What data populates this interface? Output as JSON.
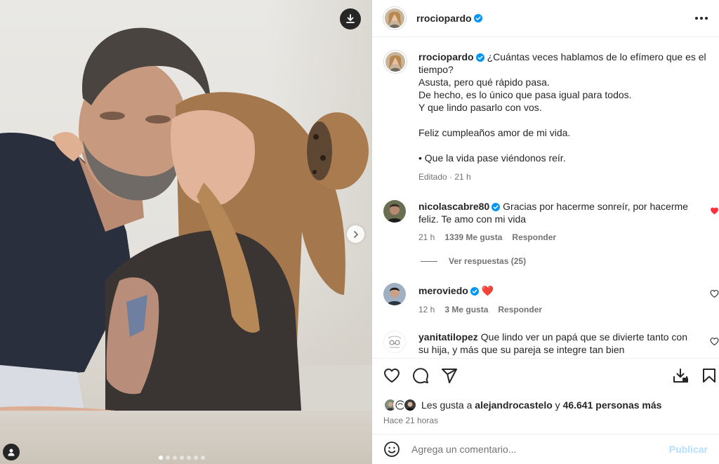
{
  "post": {
    "author": "rrociopardo",
    "carousel": {
      "total_slides": 7,
      "active_index": 0
    }
  },
  "caption": {
    "author": "rrociopardo",
    "text": "¿Cuántas veces hablamos de lo efímero que es el tiempo?\nAsusta, pero qué rápido pasa.\nDe hecho, es lo único que pasa igual para todos.\nY que lindo pasarlo con vos.\n\nFeliz cumpleaños amor de mi vida.\n\n• Que la vida pase viéndonos reír.",
    "edited": "Editado",
    "time": "21 h"
  },
  "comments": [
    {
      "author": "nicolascabre80",
      "verified": true,
      "text": "Gracias por hacerme sonreír, por hacerme feliz. Te amo con mi vida",
      "time": "21 h",
      "likes": "1339 Me gusta",
      "reply": "Responder",
      "liked": true,
      "view_replies": "Ver respuestas (25)"
    },
    {
      "author": "meroviedo",
      "verified": true,
      "text": "❤️",
      "time": "12 h",
      "likes": "3 Me gusta",
      "reply": "Responder",
      "liked": false
    },
    {
      "author": "yanitatilopez",
      "verified": false,
      "text": "Que lindo ver un papá que se divierte tanto con su hija, y más que su pareja se integre tan bien",
      "liked": false
    }
  ],
  "likes": {
    "prefix": "Les gusta a",
    "user": "alejandrocastelo",
    "and": "y",
    "others": "46.641 personas más"
  },
  "timestamp": "Hace 21 horas",
  "comment_box": {
    "placeholder": "Agrega un comentario...",
    "publish": "Publicar"
  },
  "colors": {
    "verified_blue": "#0095f6",
    "like_red": "#ff3040",
    "publish_disabled": "#b2dffc",
    "text_secondary": "#737373"
  },
  "icons": {
    "download": "download-icon",
    "next": "chevron-right-icon",
    "user_tag": "user-tag-icon",
    "more": "more-horizontal-icon",
    "like": "heart-icon",
    "comment": "comment-icon",
    "share": "paper-plane-icon",
    "save": "bookmark-icon",
    "emoji": "emoji-icon"
  }
}
